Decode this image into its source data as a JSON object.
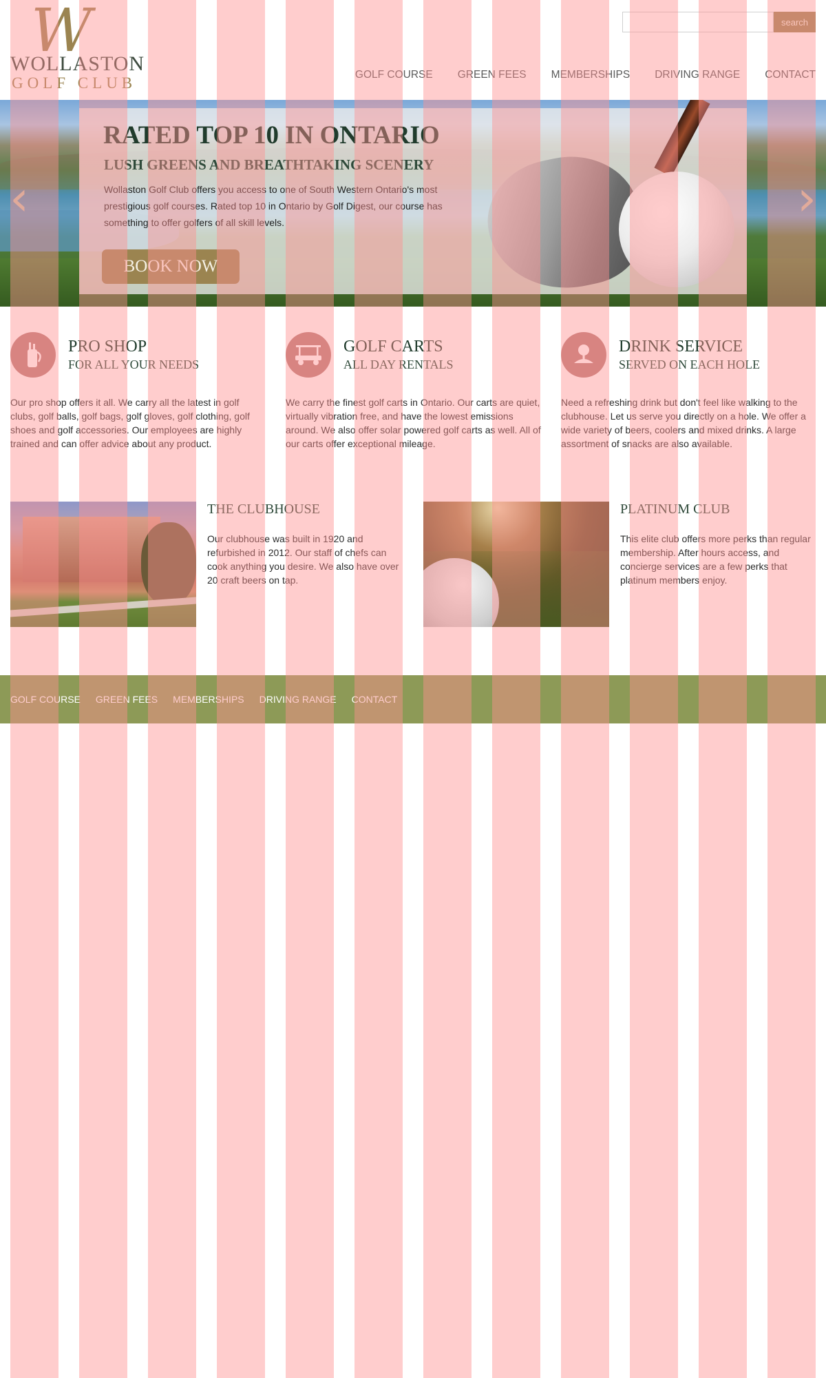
{
  "logo": {
    "monogram": "W",
    "name": "WOLLASTON",
    "subtitle": "GOLF CLUB"
  },
  "search": {
    "placeholder": "",
    "button_label": "search"
  },
  "nav": [
    {
      "label": "GOLF COURSE"
    },
    {
      "label": "GREEN FEES"
    },
    {
      "label": "MEMBERSHIPS"
    },
    {
      "label": "DRIVING RANGE"
    },
    {
      "label": "CONTACT"
    }
  ],
  "hero": {
    "title": "RATED TOP 10 IN ONTARIO",
    "subtitle": "LUSH GREENS AND BREATHTAKING SCENERY",
    "text": "Wollaston Golf Club offers you access to one of South Western Ontario's most prestigious golf courses.  Rated top 10 in Ontario by Golf Digest, our course has something to offer golfers of all skill levels.",
    "button_label": "BOOK NOW",
    "prev_arrow": "‹",
    "next_arrow": "›"
  },
  "features": [
    {
      "icon": "golf-bag-icon",
      "glyph": "⛳",
      "title": "PRO SHOP",
      "subtitle": "FOR ALL YOUR NEEDS",
      "text": "Our pro shop offers it all.  We carry all the latest in  golf clubs, golf balls, golf bags, golf gloves, golf clothing, golf shoes and golf accessories. Our employees are highly trained and can offer advice about any product."
    },
    {
      "icon": "golf-cart-icon",
      "glyph": "🚗",
      "title": "GOLF CARTS",
      "subtitle": "ALL DAY RENTALS",
      "text": "We carry the finest golf carts in Ontario.  Our carts are quiet, virtually vibration free, and have the lowest emissions around. We also offer solar powered golf carts as well. All of our carts offer exceptional mileage."
    },
    {
      "icon": "golf-ball-tee-icon",
      "glyph": "●",
      "title": "DRINK SERVICE",
      "subtitle": "SERVED ON EACH HOLE",
      "text": "Need a refreshing drink but don't feel like walking to the clubhouse.  Let us serve you directly on a hole.  We offer a wide variety of beers, coolers and mixed drinks.  A large assortment of snacks are also available."
    }
  ],
  "cards": [
    {
      "title": "THE CLUBHOUSE",
      "text": "Our clubhouse was built in 1920 and refurbished in 2012.  Our staff of chefs can cook anything you desire.  We also have over 20 craft beers on tap."
    },
    {
      "title": "PLATINUM CLUB",
      "text": "This elite club offers more perks than regular membership.  After hours access, and concierge services are a few perks that platinum members enjoy."
    }
  ],
  "footer": [
    {
      "label": "GOLF COURSE"
    },
    {
      "label": "GREEN FEES"
    },
    {
      "label": "MEMBERSHIPS"
    },
    {
      "label": "DRIVING RANGE"
    },
    {
      "label": "CONTACT"
    }
  ],
  "colors": {
    "brand_gold": "#9b8450",
    "heading_green": "#203b2c",
    "icon_badge": "#b97a76",
    "footer_green": "#8d9a57",
    "overlay_stripe": "#ff9191"
  }
}
